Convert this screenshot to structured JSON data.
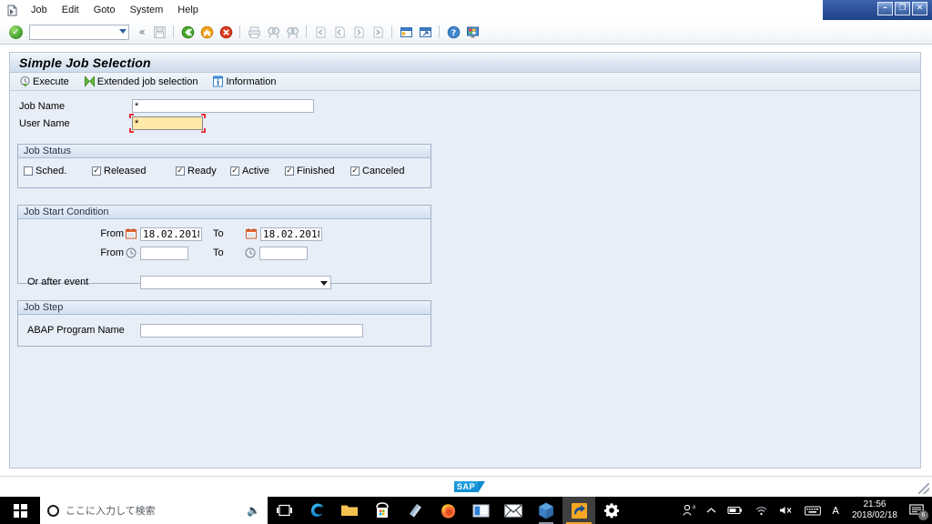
{
  "window": {
    "controls": [
      {
        "name": "minimize",
        "glyph": "–"
      },
      {
        "name": "restore",
        "glyph": "❐"
      },
      {
        "name": "close",
        "glyph": "✕"
      }
    ]
  },
  "menubar": {
    "items": [
      {
        "label": "Job",
        "accel": "J"
      },
      {
        "label": "Edit",
        "accel": "E"
      },
      {
        "label": "Goto",
        "accel": "G"
      },
      {
        "label": "System",
        "accel": "y"
      },
      {
        "label": "Help",
        "accel": "H"
      }
    ]
  },
  "toolbar": {
    "enter_icon": "enter-checkmark-icon",
    "command_field_value": "",
    "back_glyph": "«",
    "icons": [
      "save-icon",
      "back-green-icon",
      "exit-yellow-icon",
      "cancel-red-icon",
      "print-icon",
      "find-icon",
      "find-next-icon",
      "first-page-icon",
      "previous-page-icon",
      "next-page-icon",
      "last-page-icon",
      "create-session-icon",
      "create-shortcut-icon",
      "help-icon",
      "customize-local-layout-icon"
    ]
  },
  "screen": {
    "title": "Simple Job Selection",
    "app_toolbar": [
      {
        "label": "Execute",
        "icon": "execute-clock-icon"
      },
      {
        "label": "Extended job selection",
        "icon": "extended-selection-icon"
      },
      {
        "label": "Information",
        "icon": "information-icon"
      }
    ],
    "fields": [
      {
        "label": "Job Name",
        "value": "*",
        "focused": false
      },
      {
        "label": "User Name",
        "value": "*",
        "focused": true
      }
    ],
    "job_status": {
      "title": "Job Status",
      "options": [
        {
          "label": "Sched.",
          "checked": false
        },
        {
          "label": "Released",
          "checked": true
        },
        {
          "label": "Ready",
          "checked": true
        },
        {
          "label": "Active",
          "checked": true
        },
        {
          "label": "Finished",
          "checked": true
        },
        {
          "label": "Canceled",
          "checked": true
        }
      ]
    },
    "job_start_condition": {
      "title": "Job Start Condition",
      "date_from_label": "From",
      "date_from_value": "18.02.2018",
      "date_to_label": "To",
      "date_to_value": "18.02.2018",
      "time_from_label": "From",
      "time_from_value": "",
      "time_to_label": "To",
      "time_to_value": "",
      "event_label": "Or after event",
      "event_value": ""
    },
    "job_step": {
      "title": "Job Step",
      "program_label": "ABAP Program Name",
      "program_value": ""
    }
  },
  "statusbar": {
    "logo_text": "SAP"
  },
  "taskbar": {
    "search_placeholder": "ここに入力して検索",
    "apps": [
      {
        "name": "task-view",
        "label": "Task View"
      },
      {
        "name": "edge",
        "label": "Microsoft Edge"
      },
      {
        "name": "file-explorer",
        "label": "File Explorer"
      },
      {
        "name": "microsoft-store",
        "label": "Microsoft Store"
      },
      {
        "name": "notes-app",
        "label": "Notes"
      },
      {
        "name": "firefox",
        "label": "Mozilla Firefox"
      },
      {
        "name": "media-app",
        "label": "Media"
      },
      {
        "name": "mail",
        "label": "Mail"
      },
      {
        "name": "virtualbox",
        "label": "Oracle VM VirtualBox"
      },
      {
        "name": "sap-logon",
        "label": "SAP Logon"
      },
      {
        "name": "settings",
        "label": "Settings"
      }
    ],
    "tray": {
      "ime_mode": "A",
      "time": "21:56",
      "date": "2018/02/18",
      "notification_count": "6"
    }
  }
}
